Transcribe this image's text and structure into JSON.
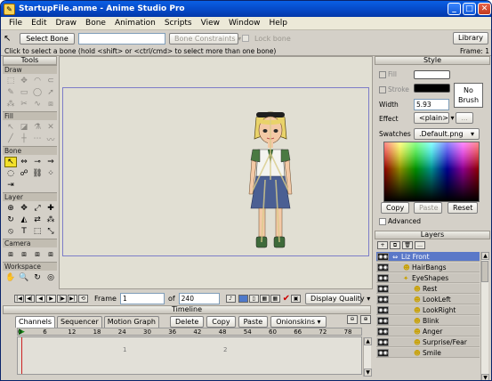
{
  "window": {
    "title": "StartupFile.anme - Anime Studio Pro"
  },
  "menu": [
    "File",
    "Edit",
    "Draw",
    "Bone",
    "Animation",
    "Scripts",
    "View",
    "Window",
    "Help"
  ],
  "toolbar": {
    "select_bone": "Select Bone",
    "bone_constraints": "Bone Constraints",
    "ik_label": "Lock bone",
    "library": "Library"
  },
  "status": {
    "hint": "Click to select a bone (hold <shift> or <ctrl/cmd> to select more than one bone)",
    "frame_label": "Frame: 1"
  },
  "tools": {
    "title": "Tools",
    "sections": [
      {
        "name": "Draw",
        "icons": [
          "add-point-icon",
          "transform-points-icon",
          "curvature-icon",
          "magnet-icon",
          "freehand-icon",
          "rectangle-icon",
          "oval-icon",
          "arrow-icon",
          "scatter-icon",
          "delete-edge-icon",
          "noise-icon",
          "perspective-icon"
        ]
      },
      {
        "name": "Fill",
        "icons": [
          "select-shape-icon",
          "create-shape-icon",
          "paint-bucket-icon",
          "delete-shape-icon",
          "line-width-icon",
          "hide-edge-icon",
          "stroke-exposure-icon",
          "curve-profile-icon"
        ]
      },
      {
        "name": "Bone",
        "icons": [
          "select-bone-icon",
          "translate-bone-icon",
          "add-bone-icon",
          "reparent-bone-icon",
          "bone-strength-icon",
          "manipulate-bones-icon",
          "bind-layer-icon",
          "bind-points-icon",
          "offset-bone-icon"
        ]
      },
      {
        "name": "Layer",
        "icons": [
          "set-origin-icon",
          "translate-layer-icon",
          "scale-layer-icon",
          "rotate-layer-icon",
          "rotate-xy-icon",
          "shear-layer-icon",
          "switch-layer-icon",
          "particle-icon",
          "eyedropper-icon",
          "insert-text-icon",
          "select-points-icon",
          "transform-icon"
        ]
      },
      {
        "name": "Camera",
        "icons": [
          "track-camera-icon",
          "zoom-camera-icon",
          "roll-camera-icon",
          "pan-tilt-camera-icon"
        ]
      },
      {
        "name": "Workspace",
        "icons": [
          "pan-workspace-icon",
          "zoom-workspace-icon",
          "rotate-workspace-icon",
          "orbit-workspace-icon"
        ]
      }
    ]
  },
  "style": {
    "title": "Style",
    "fill_label": "Fill",
    "stroke_label": "Stroke",
    "width_label": "Width",
    "width_value": "5.93",
    "no_brush": [
      "No",
      "Brush"
    ],
    "effect_label": "Effect",
    "effect_value": "<plain>",
    "effect_btn": "...",
    "swatches_label": "Swatches",
    "swatches_value": ".Default.png",
    "copy": "Copy",
    "paste": "Paste",
    "reset": "Reset",
    "advanced": "Advanced",
    "fill_color": "#ffffff",
    "stroke_color": "#000000"
  },
  "layers": {
    "title": "Layers",
    "rows": [
      {
        "label": "Liz Front",
        "indent": 0,
        "selected": true
      },
      {
        "label": "HairBangs",
        "indent": 1,
        "selected": false
      },
      {
        "label": "EyeShapes",
        "indent": 1,
        "selected": false
      },
      {
        "label": "Rest",
        "indent": 2,
        "selected": false
      },
      {
        "label": "LookLeft",
        "indent": 2,
        "selected": false
      },
      {
        "label": "LookRight",
        "indent": 2,
        "selected": false
      },
      {
        "label": "Blink",
        "indent": 2,
        "selected": false
      },
      {
        "label": "Anger",
        "indent": 2,
        "selected": false
      },
      {
        "label": "Surprise/Fear",
        "indent": 2,
        "selected": false
      },
      {
        "label": "Smile",
        "indent": 2,
        "selected": false
      }
    ]
  },
  "transport": {
    "frame_label": "Frame",
    "frame_value": "1",
    "of_label": "of",
    "total_frames": "240",
    "display_quality": "Display Quality"
  },
  "timeline": {
    "title": "Timeline",
    "tabs": [
      "Channels",
      "Sequencer",
      "Motion Graph"
    ],
    "buttons": [
      "Delete",
      "Copy",
      "Paste",
      "Onionskins"
    ],
    "ruler": [
      "0",
      "6",
      "12",
      "18",
      "24",
      "30",
      "36",
      "42",
      "48",
      "54",
      "60",
      "66",
      "72",
      "78"
    ],
    "track_marks": [
      "1",
      "2"
    ]
  }
}
